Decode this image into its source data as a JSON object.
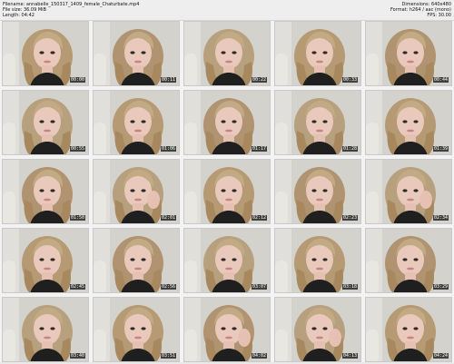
{
  "header": {
    "filename_label": "Filename:",
    "filename": "annabelle_150317_1409_female_Chaturbate.mp4",
    "filesize_label": "File size:",
    "filesize": "36.09 MiB",
    "length_label": "Length:",
    "length": "04:42",
    "dimensions_label": "Dimensions:",
    "dimensions": "640x480",
    "format_label": "Format:",
    "format": "h264 / aac (mono)",
    "fps_label": "FPS:",
    "fps": "30.00"
  },
  "thumbnails": [
    {
      "timestamp": "00:00"
    },
    {
      "timestamp": "00:11"
    },
    {
      "timestamp": "00:22"
    },
    {
      "timestamp": "00:33"
    },
    {
      "timestamp": "00:44"
    },
    {
      "timestamp": "00:55"
    },
    {
      "timestamp": "01:06"
    },
    {
      "timestamp": "01:17"
    },
    {
      "timestamp": "01:28"
    },
    {
      "timestamp": "01:39"
    },
    {
      "timestamp": "01:50"
    },
    {
      "timestamp": "02:01"
    },
    {
      "timestamp": "02:12"
    },
    {
      "timestamp": "02:23"
    },
    {
      "timestamp": "02:34"
    },
    {
      "timestamp": "02:45"
    },
    {
      "timestamp": "02:56"
    },
    {
      "timestamp": "03:07"
    },
    {
      "timestamp": "03:18"
    },
    {
      "timestamp": "03:29"
    },
    {
      "timestamp": "03:40"
    },
    {
      "timestamp": "03:51"
    },
    {
      "timestamp": "04:02"
    },
    {
      "timestamp": "04:13"
    },
    {
      "timestamp": "04:24"
    }
  ]
}
